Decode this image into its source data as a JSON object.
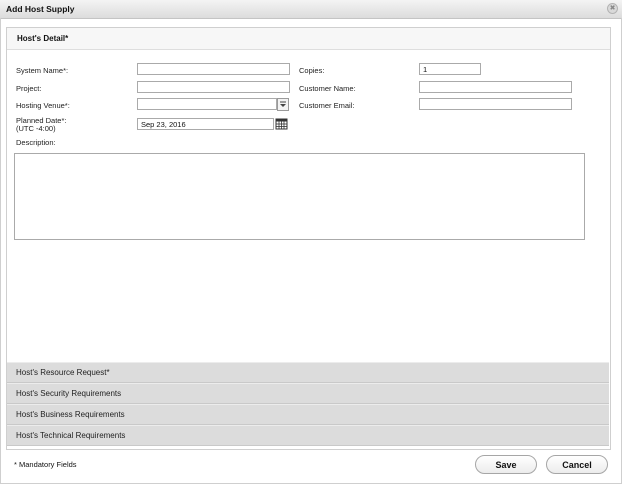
{
  "dialog": {
    "title": "Add Host Supply",
    "close_icon": "close-icon"
  },
  "panel": {
    "title": "Host's Detail*"
  },
  "form": {
    "system_name_label": "System Name*:",
    "project_label": "Project:",
    "hosting_venue_label": "Hosting Venue*:",
    "planned_date_label_line1": "Planned Date*:",
    "planned_date_label_line2": "(UTC -4:00)",
    "description_label": "Description:",
    "copies_label": "Copies:",
    "customer_name_label": "Customer Name:",
    "customer_email_label": "Customer Email:",
    "system_name_value": "",
    "project_value": "",
    "hosting_venue_value": "",
    "planned_date_value": "Sep 23, 2016",
    "copies_value": "1",
    "customer_name_value": "",
    "customer_email_value": "",
    "description_value": ""
  },
  "sections": [
    {
      "label": "Host's Resource Request*"
    },
    {
      "label": "Host's Security Requirements"
    },
    {
      "label": "Host's Business Requirements"
    },
    {
      "label": "Host's Technical Requirements"
    }
  ],
  "footer": {
    "mandatory_note": "* Mandatory Fields",
    "save_label": "Save",
    "cancel_label": "Cancel"
  }
}
